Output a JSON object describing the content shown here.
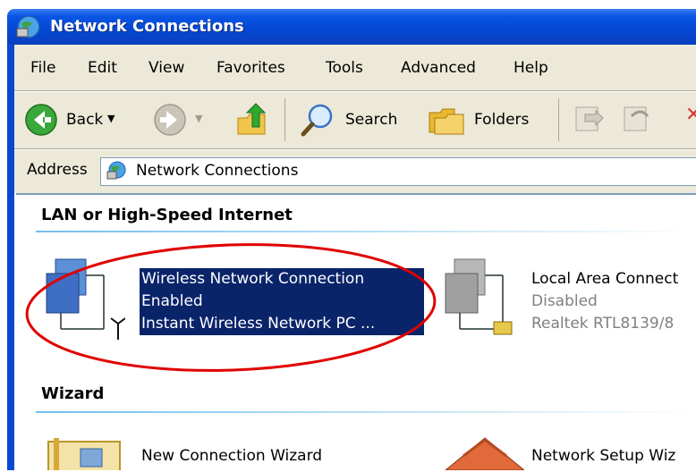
{
  "window": {
    "title": "Network Connections"
  },
  "menu": [
    "File",
    "Edit",
    "View",
    "Favorites",
    "Tools",
    "Advanced",
    "Help"
  ],
  "toolbar": {
    "back_label": "Back",
    "search_label": "Search",
    "folders_label": "Folders"
  },
  "address": {
    "label": "Address",
    "value": "Network Connections"
  },
  "groups": [
    {
      "title": "LAN or High-Speed Internet",
      "items": [
        {
          "name": "Wireless Network Connection",
          "status": "Enabled",
          "device": "Instant Wireless Network PC ...",
          "selected": true
        },
        {
          "name": "Local Area Connect",
          "status": "Disabled",
          "device": "Realtek RTL8139/8"
        }
      ]
    },
    {
      "title": "Wizard",
      "items": [
        {
          "name": "New Connection Wizard"
        },
        {
          "name": "Network Setup Wiz"
        }
      ]
    }
  ],
  "annotation": {
    "color": "#e00000",
    "shape": "ellipse"
  }
}
